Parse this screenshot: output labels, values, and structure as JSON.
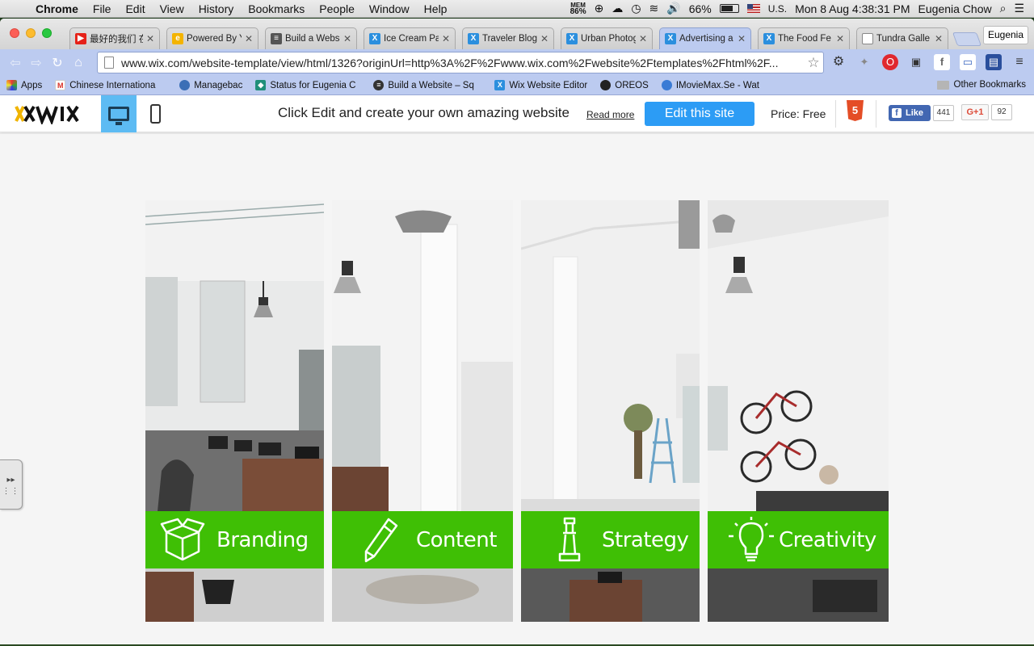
{
  "menubar": {
    "app": "Chrome",
    "items": [
      "File",
      "Edit",
      "View",
      "History",
      "Bookmarks",
      "People",
      "Window",
      "Help"
    ],
    "mem_label": "MEM",
    "mem_value": "86%",
    "battery": "66%",
    "input_source": "U.S.",
    "clock": "Mon 8 Aug  4:38:31 PM",
    "user": "Eugenia Chow"
  },
  "tabs": [
    {
      "title": "最好的我们 在",
      "favicon": "youtube-icon",
      "color": "#e62117"
    },
    {
      "title": "Powered By Y",
      "favicon": "google-doc-icon",
      "color": "#f4b400"
    },
    {
      "title": "Build a Webs",
      "favicon": "wix-stripes-icon",
      "color": "#555555"
    },
    {
      "title": "Ice Cream Pa",
      "favicon": "wix-x-icon",
      "color": "#2b8fde"
    },
    {
      "title": "Traveler Blog",
      "favicon": "wix-x-icon",
      "color": "#2b8fde"
    },
    {
      "title": "Urban Photog",
      "favicon": "wix-x-icon",
      "color": "#2b8fde"
    },
    {
      "title": "Advertising a",
      "favicon": "wix-x-icon",
      "color": "#2b8fde",
      "active": true
    },
    {
      "title": "The Food Fe",
      "favicon": "wix-x-icon",
      "color": "#2b8fde"
    },
    {
      "title": "Tundra Galle",
      "favicon": "page-icon",
      "color": "#888888"
    }
  ],
  "profile_button": "Eugenia",
  "address": {
    "url": "www.wix.com/website-template/view/html/1326?originUrl=http%3A%2F%2Fwww.wix.com%2Fwebsite%2Ftemplates%2Fhtml%2F..."
  },
  "bookmarks": [
    {
      "label": "Apps",
      "icon": "apps-grid-icon",
      "color": "#d33"
    },
    {
      "label": "Chinese Internationa",
      "icon": "gmail-icon",
      "color": "#d93025"
    },
    {
      "label": "Managebac",
      "icon": "globe-icon",
      "color": "#3b6fb6"
    },
    {
      "label": "Status for Eugenia C",
      "icon": "status-icon",
      "color": "#1f8f7a"
    },
    {
      "label": "Build a Website – Sq",
      "icon": "squarespace-icon",
      "color": "#333333"
    },
    {
      "label": "Wix Website Editor",
      "icon": "wix-x-icon",
      "color": "#2b8fde"
    },
    {
      "label": "OREOS",
      "icon": "oreo-icon",
      "color": "#222222"
    },
    {
      "label": "IMovieMax.Se - Wat",
      "icon": "imovie-icon",
      "color": "#3a7bd5"
    }
  ],
  "other_bookmarks": "Other Bookmarks",
  "wix": {
    "tagline": "Click Edit and create your own amazing website",
    "read_more": "Read more",
    "edit_button": "Edit this site",
    "price": "Price: Free",
    "html5_label": "HTML",
    "fb_like": "Like",
    "fb_count": "441",
    "gplus": "G+1",
    "gplus_count": "92"
  },
  "panels": [
    {
      "label": "Branding",
      "icon": "box-icon"
    },
    {
      "label": "Content",
      "icon": "pencil-icon"
    },
    {
      "label": "Strategy",
      "icon": "chess-piece-icon"
    },
    {
      "label": "Creativity",
      "icon": "lightbulb-icon"
    }
  ],
  "colors": {
    "accent_green": "#3fbf05",
    "wix_blue": "#2c9cf5",
    "chrome_tab_blue": "#bccbf0"
  }
}
